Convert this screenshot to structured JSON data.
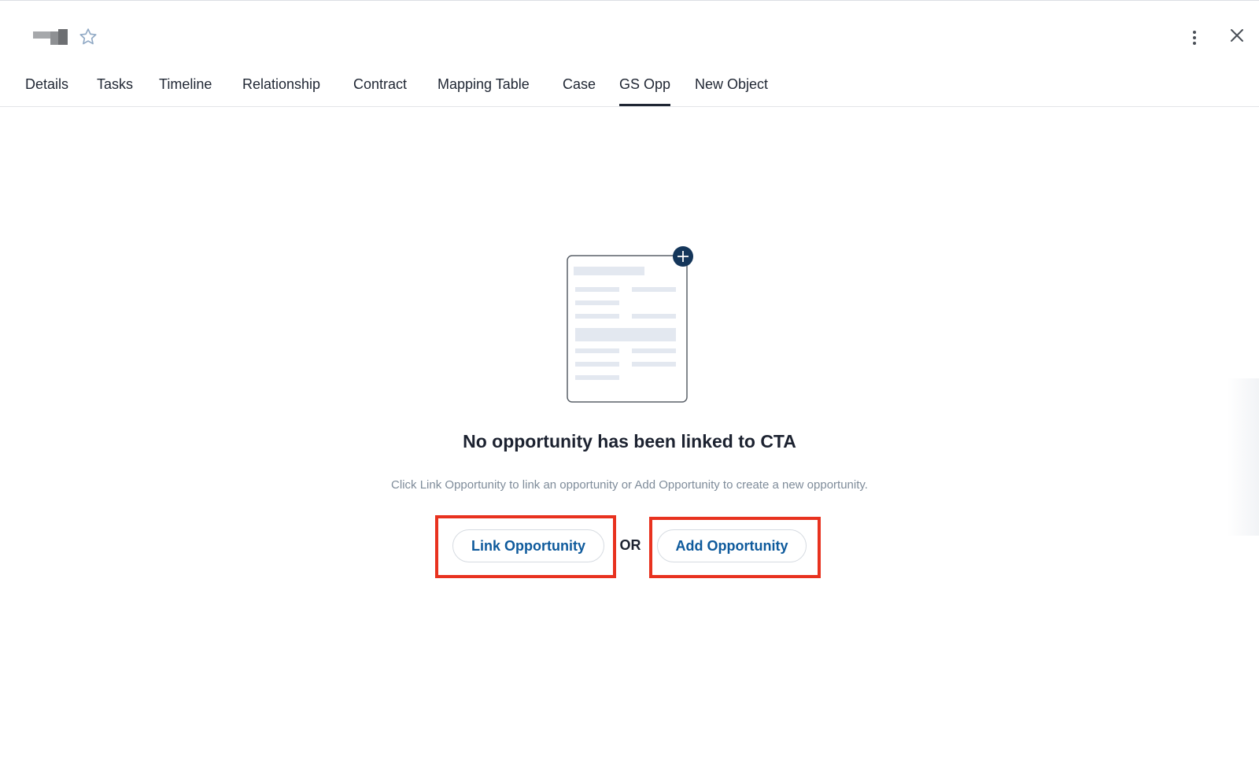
{
  "header": {
    "logo_icon": "logo-mark",
    "favorite_icon": "star-icon",
    "more_icon": "kebab-menu-icon",
    "close_icon": "close-icon"
  },
  "tabs": [
    {
      "label": "Details",
      "active": false
    },
    {
      "label": "Tasks",
      "active": false
    },
    {
      "label": "Timeline",
      "active": false
    },
    {
      "label": "Relationship",
      "active": false
    },
    {
      "label": "Contract",
      "active": false
    },
    {
      "label": "Mapping Table",
      "active": false
    },
    {
      "label": "Case",
      "active": false
    },
    {
      "label": "GS Opp",
      "active": true
    },
    {
      "label": "New Object",
      "active": false
    }
  ],
  "empty_state": {
    "illustration_icon": "document-add-icon",
    "title": "No opportunity has been linked to CTA",
    "description": "Click Link Opportunity to link an opportunity or Add Opportunity to create a new opportunity.",
    "link_button": "Link Opportunity",
    "or_text": "OR",
    "add_button": "Add Opportunity"
  },
  "colors": {
    "accent": "#0e5a9c",
    "highlight": "#e8321f",
    "text": "#1f2633",
    "muted": "#7f8c9a"
  }
}
